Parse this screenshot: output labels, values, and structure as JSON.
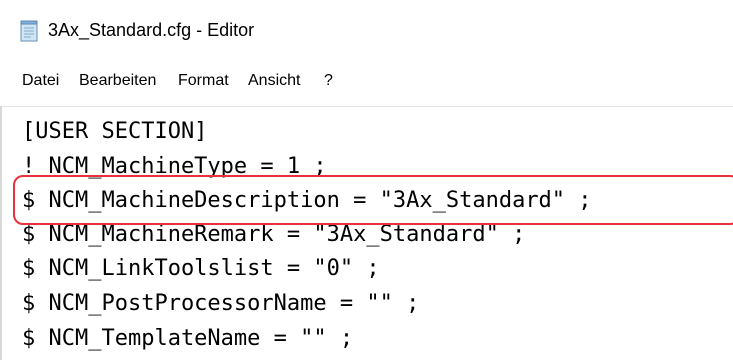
{
  "window": {
    "title": "3Ax_Standard.cfg - Editor",
    "icon": "notepad-icon"
  },
  "menu": {
    "items": [
      "Datei",
      "Bearbeiten",
      "Format",
      "Ansicht",
      "?"
    ]
  },
  "editor": {
    "lines": [
      "[USER SECTION]",
      "! NCM_MachineType = 1 ;",
      "$ NCM_MachineDescription = \"3Ax_Standard\" ;",
      "$ NCM_MachineRemark = \"3Ax_Standard\" ;",
      "$ NCM_LinkToolslist = \"0\" ;",
      "$ NCM_PostProcessorName = \"\" ;",
      "$ NCM_TemplateName = \"\" ;"
    ]
  },
  "annotation": {
    "highlight_color": "#e8313b",
    "highlighted_line": "$ NCM_MachineDescription = \"3Ax_Standard\" ;"
  }
}
